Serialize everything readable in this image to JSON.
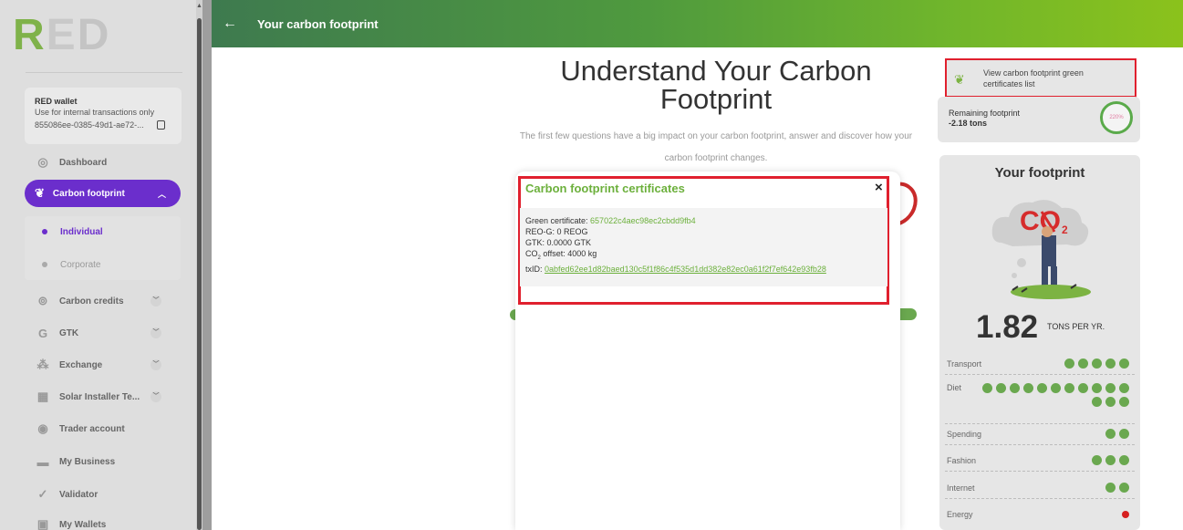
{
  "sidebar": {
    "logo_text": "RED",
    "wallet": {
      "title": "RED wallet",
      "subtitle": "Use for internal transactions only",
      "address": "855086ee-0385-49d1-ae72-..."
    },
    "items": [
      {
        "label": "Dashboard",
        "icon": "dashboard-icon"
      },
      {
        "label": "Carbon footprint",
        "icon": "footprint-icon",
        "active": true
      },
      {
        "label": "Carbon credits",
        "icon": "carbon-credits-icon"
      },
      {
        "label": "GTK",
        "icon": "gtk-icon"
      },
      {
        "label": "Exchange",
        "icon": "exchange-icon"
      },
      {
        "label": "Solar Installer Te...",
        "icon": "solar-icon"
      },
      {
        "label": "Trader account",
        "icon": "trader-icon"
      },
      {
        "label": "My Business",
        "icon": "business-icon"
      },
      {
        "label": "Validator",
        "icon": "validator-icon"
      },
      {
        "label": "My Wallets",
        "icon": "wallets-icon"
      }
    ],
    "subitems": [
      {
        "label": "Individual",
        "active": true
      },
      {
        "label": "Corporate"
      }
    ]
  },
  "header": {
    "title": "Your carbon footprint"
  },
  "main": {
    "title": "Understand Your Carbon Footprint",
    "subtitle": "The first few questions have a big impact on your carbon footprint, answer and discover how your carbon footprint changes."
  },
  "right_panel": {
    "green_list_label": "View carbon footprint green certificates list",
    "remaining_label": "Remaining footprint",
    "remaining_value": "-2.18 tons",
    "remaining_percent": "220%",
    "footprint_title": "Your footprint",
    "footprint_value": "1.82",
    "footprint_unit": "TONS PER YR.",
    "categories": [
      {
        "label": "Transport",
        "dots": 5,
        "color": "green"
      },
      {
        "label": "Diet",
        "dots": 14,
        "color": "green"
      },
      {
        "label": "Spending",
        "dots": 2,
        "color": "green"
      },
      {
        "label": "Fashion",
        "dots": 3,
        "color": "green"
      },
      {
        "label": "Internet",
        "dots": 2,
        "color": "green"
      },
      {
        "label": "Energy",
        "dots": 1,
        "color": "red"
      }
    ]
  },
  "modal": {
    "title": "Carbon footprint certificates",
    "close_label": "×",
    "green_certificate_label": "Green certificate:",
    "green_certificate_value": "657022c4aec98ec2cbdd9fb4",
    "reog_line": "REO-G: 0 REOG",
    "gtk_line": "GTK: 0.0000 GTK",
    "co2_prefix": "CO",
    "co2_sub": "2",
    "co2_suffix": " offset: 4000 kg",
    "txid_label": "txID:",
    "txid_value": "0abfed62ee1d82baed130c5f1f86c4f535d1dd382e82ec0a61f2f7ef642e93fb28"
  },
  "colors": {
    "accent_purple": "#6b2ecc",
    "brand_green": "#6cb03c",
    "highlight_red": "#e0202e"
  }
}
